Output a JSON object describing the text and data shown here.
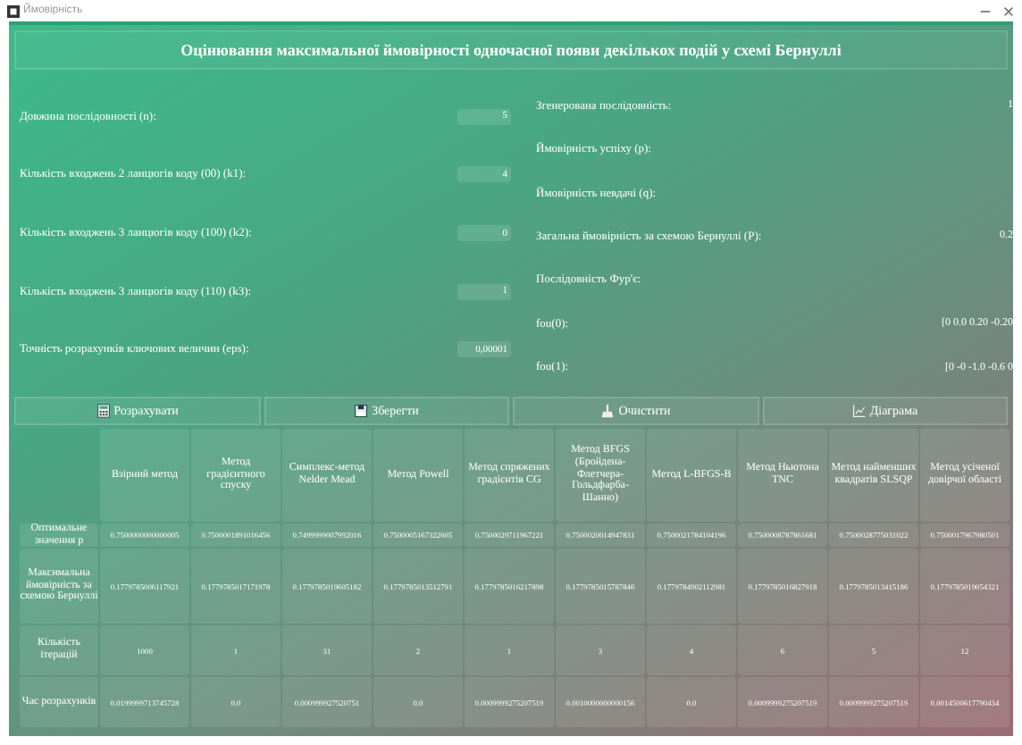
{
  "window": {
    "title": "Ймовірність"
  },
  "header": "Оцінювання максимальної ймовірності одночасної появи декількох подій у схемі Бернуллі",
  "inputs": [
    {
      "label": "Довжина послідовності (n):",
      "value": "5"
    },
    {
      "label": "Кількість входжень 2 ланцюгів коду (00) (k1):",
      "value": "4"
    },
    {
      "label": "Кількість входжень 3 ланцюгів коду (100) (k2):",
      "value": "0"
    },
    {
      "label": "Кількість входжень 3 ланцюгів коду (110) (k3):",
      "value": "1"
    },
    {
      "label": "Точність розрахунків ключових величин (eps):",
      "value": "0,00001"
    }
  ],
  "results": [
    {
      "label": "Згенерована послідовність:",
      "value": "1"
    },
    {
      "label": "Ймовірність успіху (p):"
    },
    {
      "label": "Ймовірність невдачі (q):"
    },
    {
      "label": "Загальна ймовірність за схемою Бернуллі (P):",
      "value": "0.2"
    },
    {
      "label": "Послідовність Фур'є:"
    },
    {
      "label": "fou(0):",
      "value": "[0 0.0 0.20 -0.20"
    },
    {
      "label": "fou(1):",
      "value": "[0 -0 -1.0 -0.6 0"
    }
  ],
  "buttons": [
    {
      "label": "Розрахувати",
      "kind": "calculate"
    },
    {
      "label": "Зберегти",
      "kind": "save"
    },
    {
      "label": "Очистити",
      "kind": "clear"
    },
    {
      "label": "Діаграма",
      "kind": "chart"
    }
  ],
  "table": {
    "columns": [
      "Взірний метод",
      "Метод градієнтного спуску",
      "Симплекс-метод Nelder Mead",
      "Метод Powell",
      "Метод спряжених градієнтів CG",
      "Метод BFGS (Бройдена-Флетчера-Гольдфарба-Шанно)",
      "Метод L-BFGS-B",
      "Метод Ньютона TNC",
      "Метод найменших квадратів SLSQP",
      "Метод усіченої довірчої області"
    ],
    "rows": [
      {
        "header": "Оптимальне значення p",
        "cells": [
          "0.7500000000000005",
          "0.7500001891016456",
          "0.7499999007992016",
          "0.7500005167322605",
          "0.7500029711967221",
          "0.7500020014947831",
          "0.7500021784104196",
          "0.7500008787861681",
          "0.7500028775031022",
          "0.7500017967980501"
        ]
      },
      {
        "header": "Максимальна ймовірність за схемою Бернуллі",
        "cells": [
          "0.1779785006117921",
          "0.1779785017171978",
          "0.1779785019605182",
          "0.1779785013512791",
          "0.1779785016217898",
          "0.1779785015787846",
          "0.1779784902112981",
          "0.1779785016827918",
          "0.1779785013415186",
          "0.1779785019054321"
        ]
      },
      {
        "header": "Кількість ітерацій",
        "cells": [
          "1000",
          "1",
          "31",
          "2",
          "1",
          "3",
          "4",
          "6",
          "5",
          "12"
        ]
      },
      {
        "header": "Час розрахунків",
        "cells": [
          "0.0199999713745728",
          "0.0",
          "0.000999927520751",
          "0.0",
          "0.0009999275207519",
          "0.0010000000000156",
          "0.0",
          "0.0009999275207519",
          "0.0009999275207519",
          "0.0014500617790434"
        ]
      }
    ]
  }
}
